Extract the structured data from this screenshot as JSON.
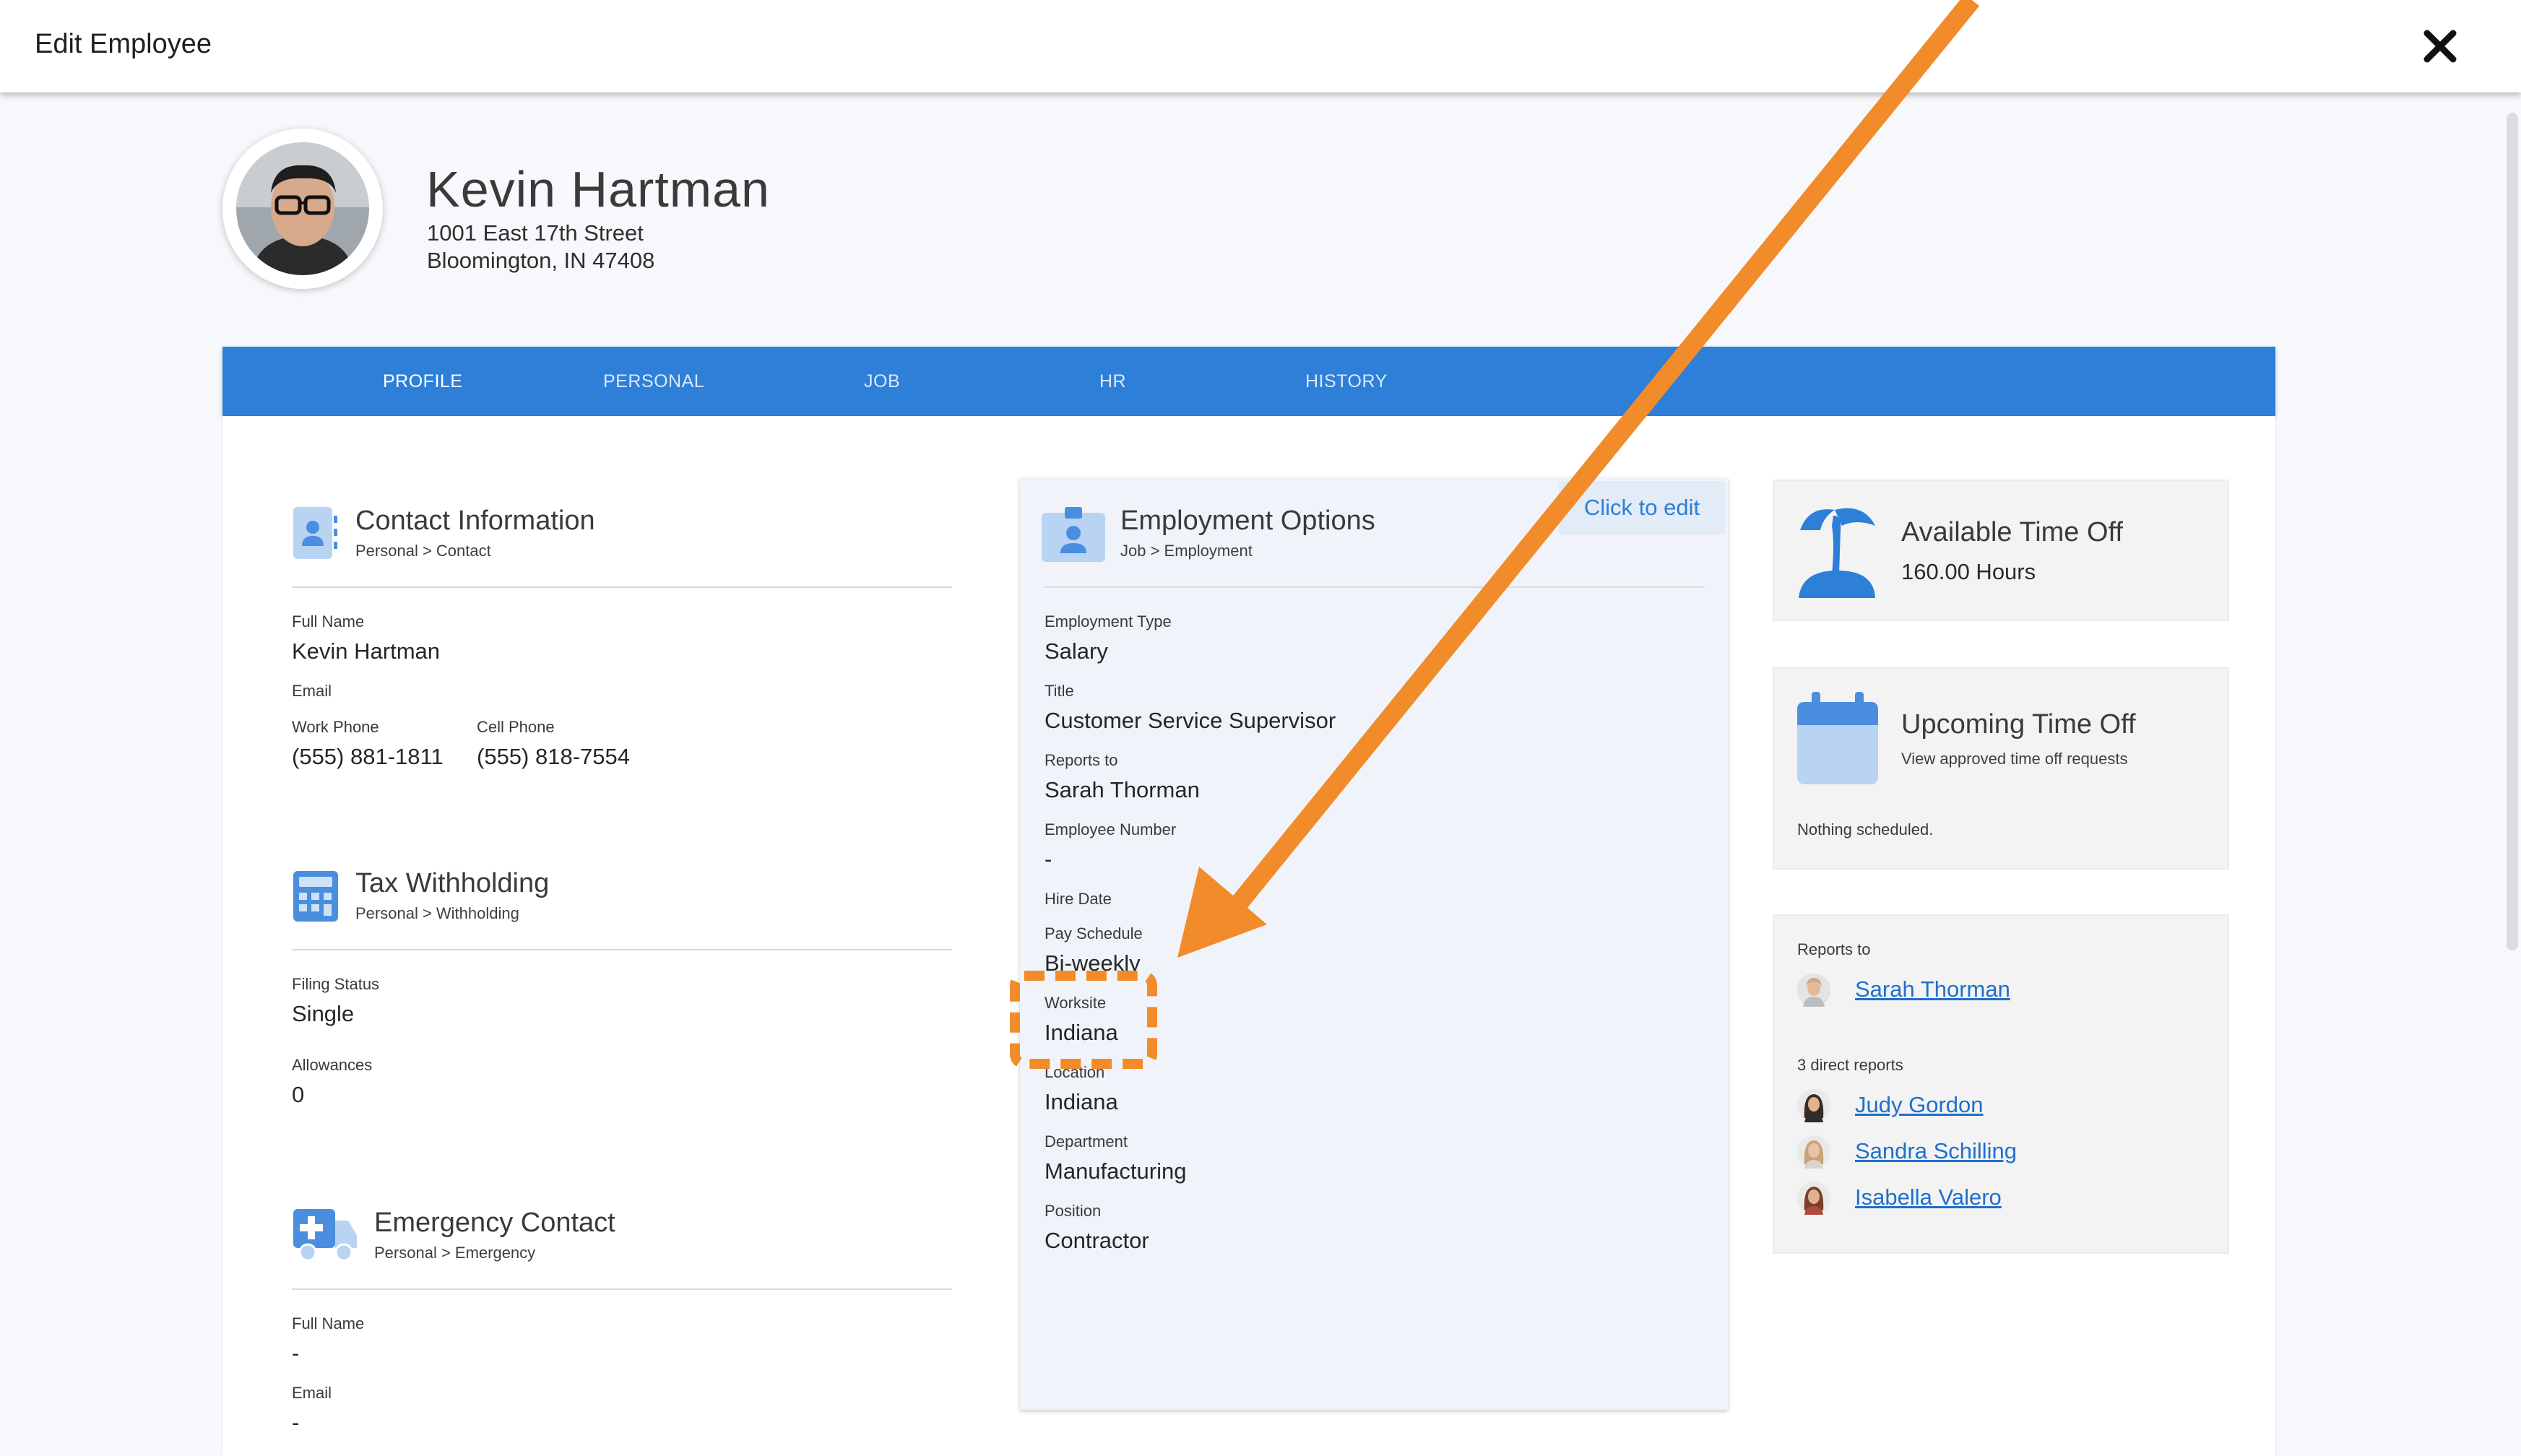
{
  "window": {
    "title": "Edit Employee"
  },
  "employee": {
    "name": "Kevin Hartman",
    "address_line1": "1001 East 17th Street",
    "address_line2": "Bloomington, IN 47408"
  },
  "tabs": [
    {
      "label": "PROFILE",
      "active": true
    },
    {
      "label": "PERSONAL"
    },
    {
      "label": "JOB"
    },
    {
      "label": "HR"
    },
    {
      "label": "HISTORY"
    }
  ],
  "contact": {
    "title": "Contact Information",
    "breadcrumb": "Personal > Contact",
    "full_name_label": "Full Name",
    "full_name": "Kevin Hartman",
    "email_label": "Email",
    "work_phone_label": "Work Phone",
    "work_phone": "(555) 881-1811",
    "cell_phone_label": "Cell Phone",
    "cell_phone": "(555) 818-7554"
  },
  "tax": {
    "title": "Tax Withholding",
    "breadcrumb": "Personal > Withholding",
    "filing_status_label": "Filing Status",
    "filing_status": "Single",
    "allowances_label": "Allowances",
    "allowances": "0"
  },
  "emergency": {
    "title": "Emergency Contact",
    "breadcrumb": "Personal > Emergency",
    "full_name_label": "Full Name",
    "full_name": "-",
    "email_label": "Email",
    "email": "-"
  },
  "employment": {
    "title": "Employment Options",
    "breadcrumb": "Job > Employment",
    "edit_label": "Click to edit",
    "fields": [
      {
        "label": "Employment Type",
        "value": "Salary"
      },
      {
        "label": "Title",
        "value": "Customer Service Supervisor"
      },
      {
        "label": "Reports to",
        "value": "Sarah Thorman"
      },
      {
        "label": "Employee Number",
        "value": "-"
      },
      {
        "label": "Hire Date",
        "value": ""
      },
      {
        "label": "Pay Schedule",
        "value": "Bi-weekly"
      },
      {
        "label": "Worksite",
        "value": "Indiana"
      },
      {
        "label": "Location",
        "value": "Indiana"
      },
      {
        "label": "Department",
        "value": "Manufacturing"
      },
      {
        "label": "Position",
        "value": "Contractor"
      }
    ]
  },
  "time_off": {
    "available_title": "Available Time Off",
    "available_value": "160.00 Hours",
    "upcoming_title": "Upcoming Time Off",
    "upcoming_sub": "View approved time off requests",
    "upcoming_empty": "Nothing scheduled."
  },
  "reports": {
    "reports_to_label": "Reports to",
    "manager": "Sarah Thorman",
    "direct_reports_label": "3 direct reports",
    "direct": [
      "Judy Gordon",
      "Sandra Schilling",
      "Isabella Valero"
    ]
  },
  "colors": {
    "accent": "#2d7fd8",
    "annotation": "#f28b2a",
    "icon": "#5b9be6"
  }
}
